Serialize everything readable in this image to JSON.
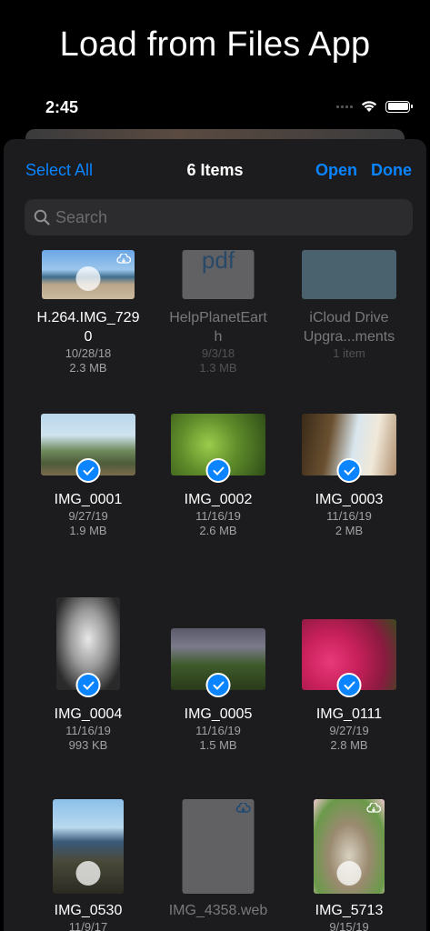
{
  "banner": {
    "title": "Load from Files App"
  },
  "status": {
    "time": "2:45"
  },
  "nav": {
    "select_all": "Select All",
    "title": "6 Items",
    "open": "Open",
    "done": "Done"
  },
  "search": {
    "placeholder": "Search",
    "value": ""
  },
  "files": [
    {
      "name": "H.264.IMG_729\n0",
      "date": "10/28/18",
      "size": "2.3 MB",
      "selected": false,
      "cloud": true,
      "dimmed": false
    },
    {
      "name": "HelpPlanetEart\nh",
      "date": "9/3/18",
      "size": "1.3 MB",
      "selected": false,
      "cloud": false,
      "dimmed": true,
      "thumb_text": "pdf"
    },
    {
      "name": "iCloud Drive\nUpgra...ments",
      "date": "",
      "size": "1 item",
      "selected": false,
      "cloud": false,
      "dimmed": true
    },
    {
      "name": "IMG_0001",
      "date": "9/27/19",
      "size": "1.9 MB",
      "selected": true,
      "cloud": false,
      "dimmed": false
    },
    {
      "name": "IMG_0002",
      "date": "11/16/19",
      "size": "2.6 MB",
      "selected": true,
      "cloud": false,
      "dimmed": false
    },
    {
      "name": "IMG_0003",
      "date": "11/16/19",
      "size": "2 MB",
      "selected": true,
      "cloud": false,
      "dimmed": false
    },
    {
      "name": "IMG_0004",
      "date": "11/16/19",
      "size": "993 KB",
      "selected": true,
      "cloud": false,
      "dimmed": false
    },
    {
      "name": "IMG_0005",
      "date": "11/16/19",
      "size": "1.5 MB",
      "selected": true,
      "cloud": false,
      "dimmed": false
    },
    {
      "name": "IMG_0111",
      "date": "9/27/19",
      "size": "2.8 MB",
      "selected": true,
      "cloud": false,
      "dimmed": false
    },
    {
      "name": "IMG_0530",
      "date": "11/9/17",
      "size": "",
      "selected": false,
      "cloud": false,
      "dimmed": false
    },
    {
      "name": "IMG_4358.web",
      "date": "",
      "size": "",
      "selected": false,
      "cloud": true,
      "dimmed": true
    },
    {
      "name": "IMG_5713",
      "date": "9/15/19",
      "size": "",
      "selected": false,
      "cloud": true,
      "dimmed": false
    }
  ],
  "colors": {
    "accent": "#0a84ff",
    "sheet": "#1c1c1e",
    "search_bg": "#2c2c2e"
  },
  "icons": {
    "search": "magnifying-glass-icon",
    "cloud": "cloud-download-icon",
    "check": "checkmark-icon",
    "wifi": "wifi-icon",
    "battery": "battery-icon"
  }
}
